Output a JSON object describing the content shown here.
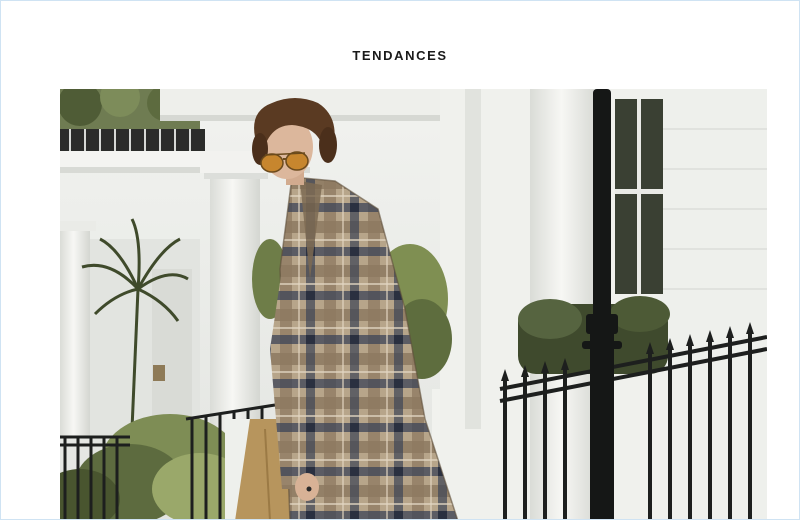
{
  "page": {
    "heading": "TENDANCES"
  },
  "photo": {
    "subject": "fashion-photo",
    "colors": {
      "building": "#ecedea",
      "column": "#f6f6f3",
      "shadow": "#d3d6d1",
      "foliage": "#5d6b3f",
      "foliage_light": "#8a9a5c",
      "railing": "#1d1f1e",
      "coat_light": "#b7a58a",
      "coat_mid": "#8d7960",
      "coat_dark": "#3c4456",
      "trousers": "#b7955d",
      "hair": "#5a3a22",
      "skin": "#dcb79c",
      "lens": "#c7862e"
    }
  }
}
